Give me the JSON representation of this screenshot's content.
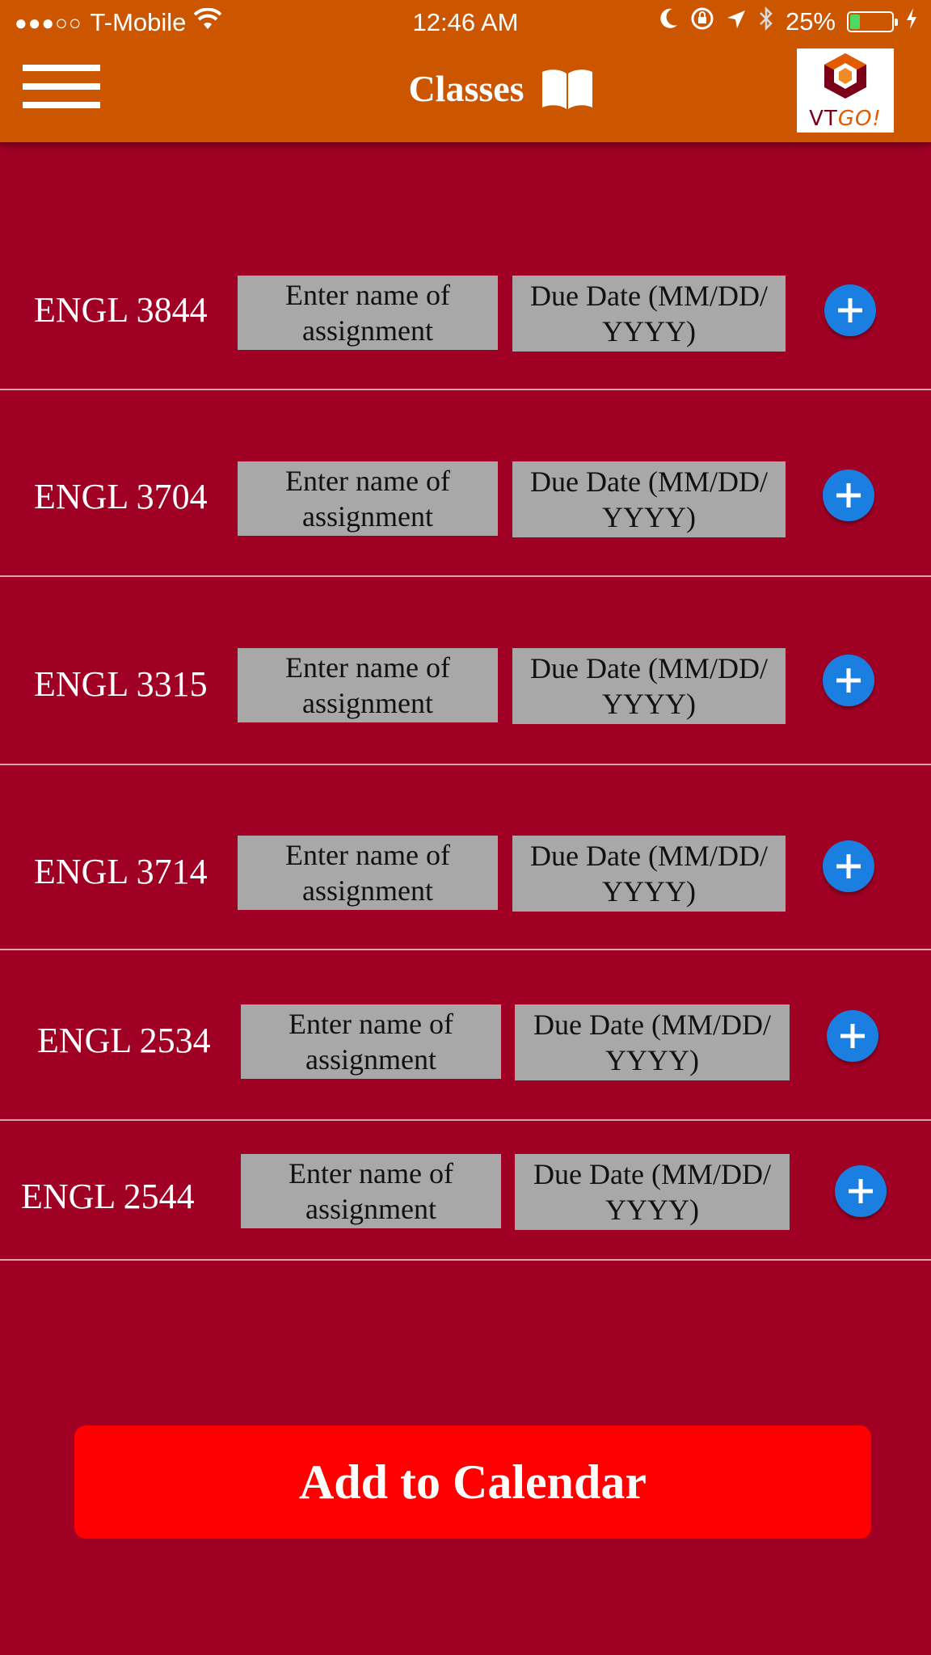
{
  "status_bar": {
    "signal": "●●●○○",
    "carrier": "T-Mobile",
    "time": "12:46 AM",
    "battery": "25%",
    "battery_color": "#4cd964"
  },
  "header": {
    "title": "Classes",
    "title_icon": "book-icon",
    "menu_icon": "hamburger-menu-icon",
    "logo_text_part1": "VT",
    "logo_text_part2": "GO!",
    "background": "#cc5500"
  },
  "colors": {
    "page_background": "#a00024",
    "field_background": "#a8a8a8",
    "add_button": "#1a7fe0",
    "calendar_button": "#fe0000"
  },
  "classes": [
    {
      "course": "ENGL 3844",
      "assignment_placeholder": "Enter name of assignment",
      "due_placeholder": "Due Date (MM/DD/ YYYY)"
    },
    {
      "course": "ENGL 3704",
      "assignment_placeholder": "Enter name of assignment",
      "due_placeholder": "Due Date (MM/DD/ YYYY)"
    },
    {
      "course": "ENGL 3315",
      "assignment_placeholder": "Enter name of assignment",
      "due_placeholder": "Due Date (MM/DD/ YYYY)"
    },
    {
      "course": "ENGL 3714",
      "assignment_placeholder": "Enter name of assignment",
      "due_placeholder": "Due Date (MM/DD/ YYYY)"
    },
    {
      "course": "ENGL 2534",
      "assignment_placeholder": "Enter name of assignment",
      "due_placeholder": "Due Date (MM/DD/ YYYY)"
    },
    {
      "course": "ENGL 2544",
      "assignment_placeholder": "Enter name of assignment",
      "due_placeholder": "Due Date (MM/DD/ YYYY)"
    }
  ],
  "add_to_calendar_label": "Add to Calendar"
}
